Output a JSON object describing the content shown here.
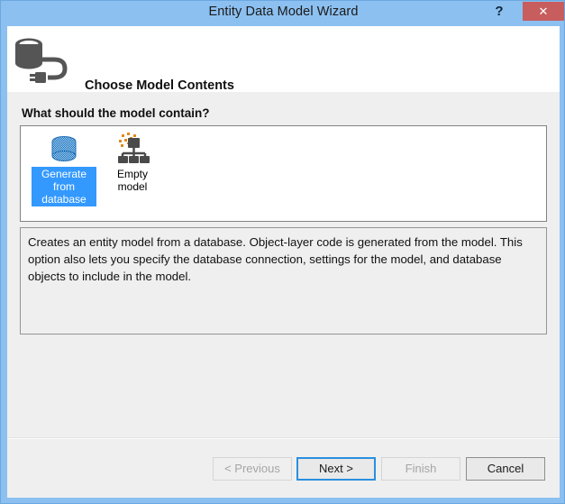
{
  "window": {
    "title": "Entity Data Model Wizard",
    "help_label": "?",
    "close_label": "✕",
    "border_color": "#8cc0f0",
    "close_color": "#c75d5d"
  },
  "header": {
    "icon": "database-plug-icon",
    "title": "Choose Model Contents"
  },
  "body": {
    "prompt": "What should the model contain?",
    "models": [
      {
        "label": "Generate from database",
        "icon": "database-cylinder-icon",
        "selected": true
      },
      {
        "label": "Empty model",
        "icon": "empty-model-hierarchy-icon",
        "selected": false
      }
    ],
    "description": "Creates an entity model from a database. Object-layer code is generated from the model. This option also lets you specify the database connection, settings for the model, and database objects to include in the model.",
    "selection_color": "#3399ff"
  },
  "footer": {
    "previous_label": "< Previous",
    "next_label": "Next >",
    "finish_label": "Finish",
    "cancel_label": "Cancel"
  }
}
